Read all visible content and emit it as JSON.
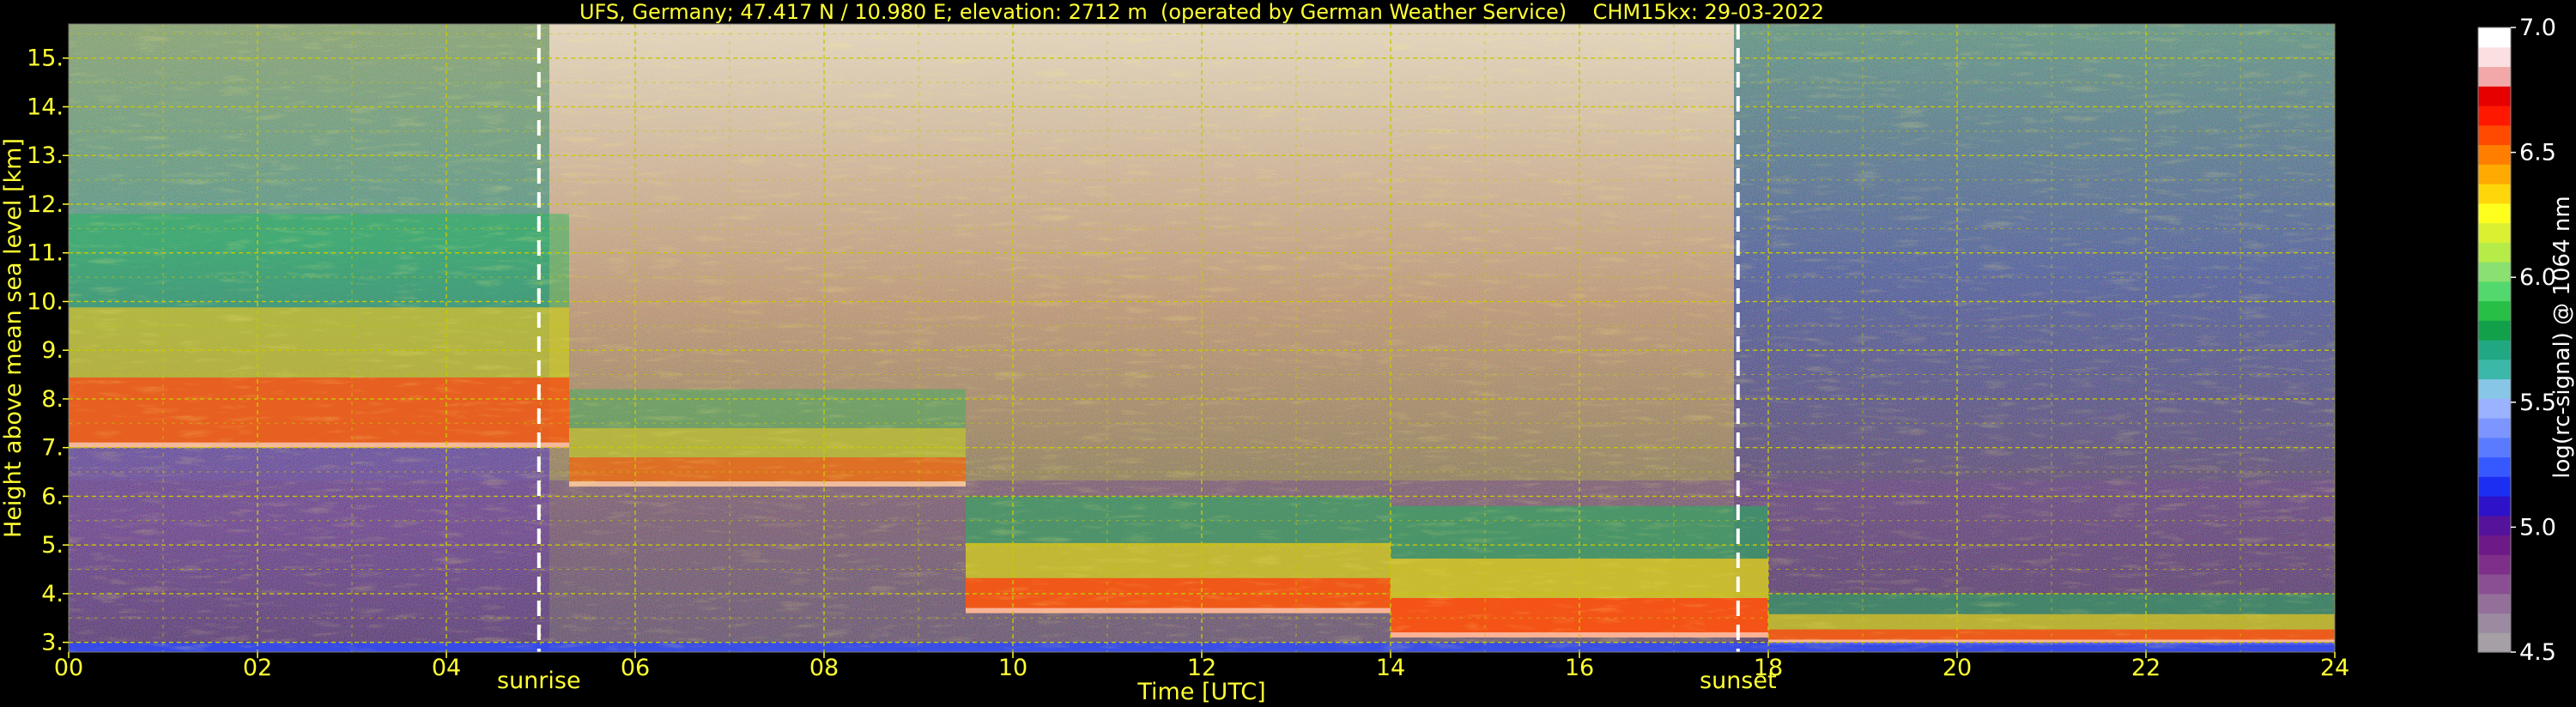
{
  "header": {
    "title": "UFS, Germany; 47.417 N / 10.980 E; elevation: 2712 m  (operated by German Weather Service)    CHM15kx: 29-03-2022"
  },
  "colors": {
    "axis_text": "#ffff33",
    "grid": "#c8c800",
    "background": "#000000",
    "colorbar_text": "#ffffff"
  },
  "chart_data": {
    "type": "heatmap",
    "title": "UFS, Germany; 47.417 N / 10.980 E; elevation: 2712 m  (operated by German Weather Service)    CHM15kx: 29-03-2022",
    "xlabel": "Time [UTC]",
    "ylabel": "Height above mean sea level [km]",
    "xlim": [
      0,
      24
    ],
    "ylim": [
      2.8,
      15.7
    ],
    "grid": true,
    "x_ticks": [
      {
        "v": 0,
        "label": "00"
      },
      {
        "v": 2,
        "label": "02"
      },
      {
        "v": 4,
        "label": "04"
      },
      {
        "v": 6,
        "label": "06"
      },
      {
        "v": 8,
        "label": "08"
      },
      {
        "v": 10,
        "label": "10"
      },
      {
        "v": 12,
        "label": "12"
      },
      {
        "v": 14,
        "label": "14"
      },
      {
        "v": 16,
        "label": "16"
      },
      {
        "v": 18,
        "label": "18"
      },
      {
        "v": 20,
        "label": "20"
      },
      {
        "v": 22,
        "label": "22"
      },
      {
        "v": 24,
        "label": "24"
      }
    ],
    "y_ticks": [
      {
        "v": 3,
        "label": "3."
      },
      {
        "v": 4,
        "label": "4."
      },
      {
        "v": 5,
        "label": "5."
      },
      {
        "v": 6,
        "label": "6."
      },
      {
        "v": 7,
        "label": "7."
      },
      {
        "v": 8,
        "label": "8."
      },
      {
        "v": 9,
        "label": "9."
      },
      {
        "v": 10,
        "label": "10."
      },
      {
        "v": 11,
        "label": "11."
      },
      {
        "v": 12,
        "label": "12."
      },
      {
        "v": 13,
        "label": "13."
      },
      {
        "v": 14,
        "label": "14."
      },
      {
        "v": 15,
        "label": "15."
      }
    ],
    "annotations": [
      {
        "label": "sunrise",
        "time": 4.98
      },
      {
        "label": "sunset",
        "time": 17.68
      }
    ],
    "cloud_layers": [
      {
        "t_start": 0.0,
        "t_end": 5.3,
        "base_km": 7.0,
        "top_km": 11.8,
        "strength": 0.85
      },
      {
        "t_start": 5.3,
        "t_end": 9.5,
        "base_km": 6.2,
        "top_km": 8.2,
        "strength": 0.7
      },
      {
        "t_start": 9.5,
        "t_end": 14.0,
        "base_km": 3.6,
        "top_km": 6.0,
        "strength": 0.95
      },
      {
        "t_start": 14.0,
        "t_end": 18.0,
        "base_km": 3.1,
        "top_km": 5.8,
        "strength": 1.0
      },
      {
        "t_start": 18.0,
        "t_end": 24.0,
        "base_km": 2.95,
        "top_km": 4.0,
        "strength": 0.9
      }
    ],
    "colorbar": {
      "label": "log(rc-signal) @ 1064 nm",
      "range": [
        4.5,
        7.0
      ],
      "ticks": [
        {
          "v": 4.5,
          "label": "4.5"
        },
        {
          "v": 5.0,
          "label": "5.0"
        },
        {
          "v": 5.5,
          "label": "5.5"
        },
        {
          "v": 6.0,
          "label": "6.0"
        },
        {
          "v": 6.5,
          "label": "6.5"
        },
        {
          "v": 7.0,
          "label": "7.0"
        }
      ],
      "colors": [
        "#a6a0a6",
        "#9c8aa0",
        "#946f9a",
        "#8a4f92",
        "#7d2f89",
        "#6e1a86",
        "#55129a",
        "#2d12c9",
        "#1c2ef2",
        "#3658ff",
        "#5a7bff",
        "#7d96ff",
        "#9ab2ff",
        "#88c6e8",
        "#3cb8a8",
        "#21a882",
        "#12a04a",
        "#28bf46",
        "#52d86c",
        "#8ae070",
        "#b6ec48",
        "#dcf032",
        "#ffff1e",
        "#ffd60a",
        "#ffaa00",
        "#ff7e00",
        "#ff4a00",
        "#ff1800",
        "#e60000",
        "#f2a8a8",
        "#fae0e0",
        "#ffffff"
      ]
    }
  }
}
